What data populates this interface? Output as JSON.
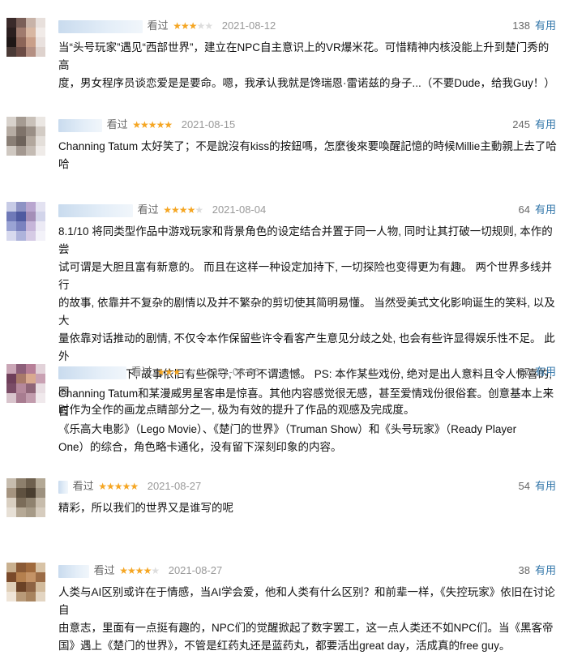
{
  "reviews": [
    {
      "seen": "看过",
      "rating": 3,
      "date": "2021-08-12",
      "votes": "138",
      "useful": "有用",
      "content": "当“头号玩家”遇见“西部世界”，建立在NPC自主意识上的VR爆米花。可惜精神内核没能上升到楚门秀的高\n度，男女程序员谈恋爱是是要命。嗯，我承认我就是馋瑞恩·雷诺兹的身子...（不要Dude，给我Guy！）"
    },
    {
      "seen": "看过",
      "rating": 5,
      "date": "2021-08-15",
      "votes": "245",
      "useful": "有用",
      "content": "Channing Tatum 太好笑了；不是說沒有kiss的按鈕嗎，怎麼後來要喚醒記憶的時候Millie主動親上去了哈哈"
    },
    {
      "seen": "看过",
      "rating": 4,
      "date": "2021-08-04",
      "votes": "64",
      "useful": "有用",
      "content": "8.1/10 将同类型作品中游戏玩家和背景角色的设定结合并置于同一人物, 同时让其打破一切规则, 本作的尝\n试可谓是大胆且富有新意的。 而且在这样一种设定加持下, 一切探险也变得更为有趣。 两个世界多线并行\n的故事, 依靠并不复杂的剧情以及并不繁杂的剪切使其简明易懂。 当然受美式文化影响诞生的笑料, 以及大\n量依靠对话推动的剧情, 不仅令本作保留些许令看客产生意见分歧之处, 也会有些许显得娱乐性不足。 此外\n在创新的包装下, 故事依旧有些保守, 不可不谓遗憾。 PS: 本作某些戏份, 绝对是出人意料且令人惊喜的, 同\n时作为全作的画龙点睛部分之一, 极为有效的提升了作品的观感及完成度。"
    },
    {
      "seen": "看过",
      "rating": 3,
      "date": "2021-08-06",
      "votes": "87",
      "useful": "有用",
      "content": "Channing Tatum和某漫威男星客串是惊喜。其他内容感觉很无感，甚至爱情戏份很俗套。创意基本上来自\n《乐高大电影》（Lego Movie）、《楚门的世界》（Truman Show）和《头号玩家》（Ready Player\nOne）的综合，角色略卡通化，没有留下深刻印象的内容。"
    },
    {
      "seen": "看过",
      "rating": 5,
      "date": "2021-08-27",
      "votes": "54",
      "useful": "有用",
      "content": "精彩，所以我们的世界又是谁写的呢"
    },
    {
      "seen": "看过",
      "rating": 4,
      "date": "2021-08-27",
      "votes": "38",
      "useful": "有用",
      "content": "人类与AI区别或许在于情感，当AI学会爱，他和人类有什么区别？和前辈一样，《失控玩家》依旧在讨论自\n由意志，里面有一点挺有趣的，NPC们的觉醒掀起了数字罢工，这一点人类还不如NPC们。当《黑客帝\n国》遇上《楚门的世界》，不管是红药丸还是蓝药丸，都要活出great day，活成真的free guy。"
    }
  ]
}
